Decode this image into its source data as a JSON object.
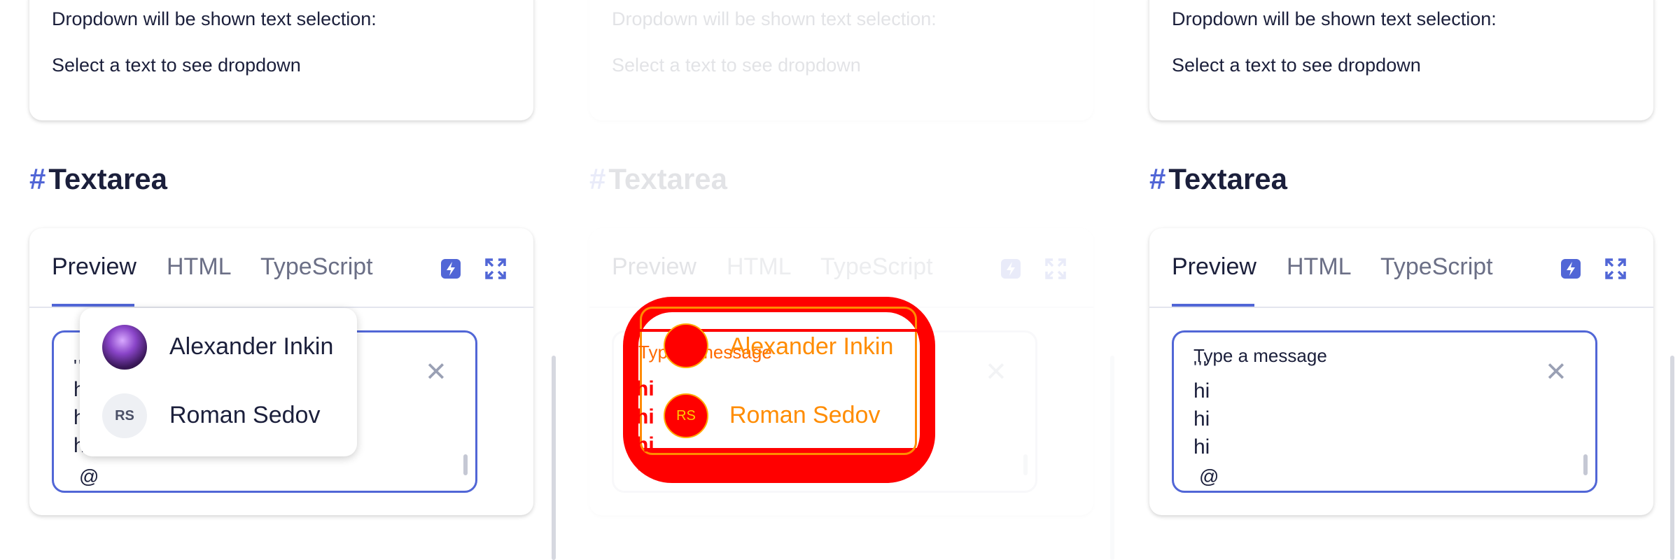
{
  "top_card": {
    "title": "Dropdown will be shown text selection:",
    "hint": "Select a text to see dropdown"
  },
  "section": {
    "hash": "#",
    "title": "Textarea"
  },
  "tabs": {
    "preview": "Preview",
    "html": "HTML",
    "typescript": "TypeScript"
  },
  "icons": {
    "flash": "flash-icon",
    "expand": "expand-icon",
    "clear": "close-icon"
  },
  "textarea": {
    "placeholder": "Type a message",
    "overflow": "'''",
    "lines": [
      "hi",
      "hi",
      "hi"
    ],
    "trigger": "@"
  },
  "mentions": {
    "options": [
      {
        "name": "Alexander Inkin",
        "initials": ""
      },
      {
        "name": "Roman Sedov",
        "initials": "RS"
      }
    ]
  },
  "colors": {
    "accent": "#5166d6",
    "text": "#1b1f3b",
    "highlight": "#ff0000"
  }
}
